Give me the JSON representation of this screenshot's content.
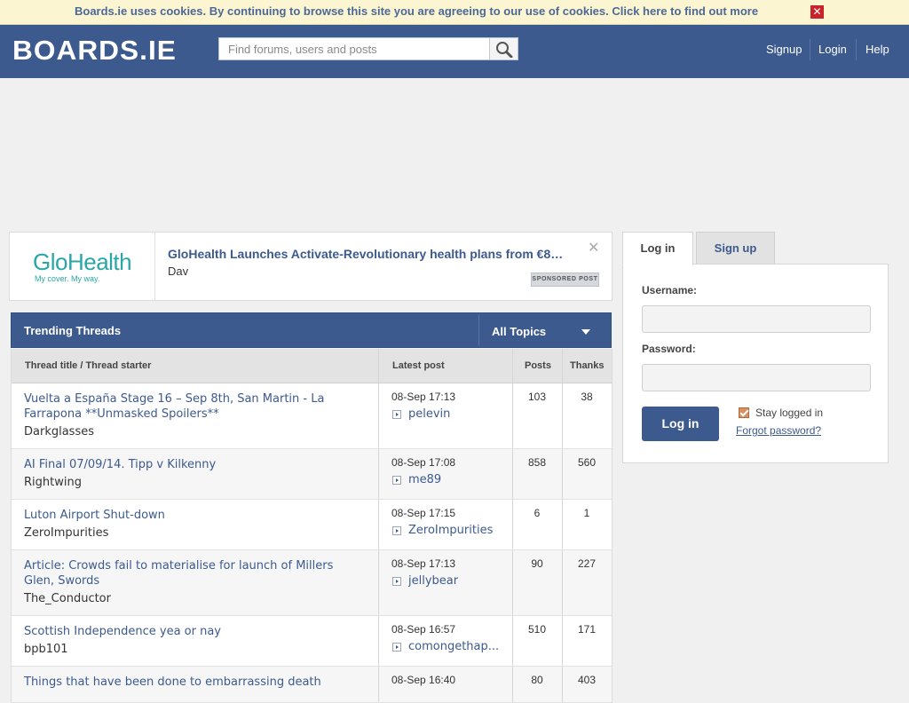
{
  "cookie_bar": {
    "message": "Boards.ie uses cookies. By continuing to browse this site you are agreeing to our use of cookies. Click here to find out more",
    "close_glyph": "✕"
  },
  "header": {
    "logo": "BOARDS.IE",
    "search_placeholder": "Find forums, users and posts",
    "nav": [
      "Signup",
      "Login",
      "Help"
    ]
  },
  "sponsored": {
    "logo_main": "GloHealth",
    "logo_sub": "My cover. My way.",
    "title": "GloHealth Launches Activate-Revolutionary health plans from €8…",
    "author": "Dav",
    "close_glyph": "✕",
    "badge": "SPONSORED POST"
  },
  "trending": {
    "title": "Trending Threads",
    "filter": "All Topics",
    "columns": [
      "Thread title / Thread starter",
      "Latest post",
      "Posts",
      "Thanks"
    ],
    "rows": [
      {
        "title": "Vuelta a España Stage 16 – Sep 8th, San Martin - La Farrapona **Unmasked Spoilers**",
        "starter": "Darkglasses",
        "date": "08-Sep 17:13",
        "last_user": "pelevin",
        "posts": "103",
        "thanks": "38"
      },
      {
        "title": "AI Final 07/09/14. Tipp v Kilkenny",
        "starter": "Rightwing",
        "date": "08-Sep 17:08",
        "last_user": "me89",
        "posts": "858",
        "thanks": "560"
      },
      {
        "title": "Luton Airport Shut-down",
        "starter": "ZeroImpurities",
        "date": "08-Sep 17:15",
        "last_user": "ZeroImpurities",
        "posts": "6",
        "thanks": "1"
      },
      {
        "title": "Article: Crowds fail to materialise for launch of Millers Glen, Swords",
        "starter": "The_Conductor",
        "date": "08-Sep 17:13",
        "last_user": "jellybear",
        "posts": "90",
        "thanks": "227"
      },
      {
        "title": "Scottish Independence yea or nay",
        "starter": "bpb101",
        "date": "08-Sep 16:57",
        "last_user": "comongethap...",
        "posts": "510",
        "thanks": "171"
      },
      {
        "title": "Things that have been done to embarrassing death",
        "starter": "",
        "date": "08-Sep 16:40",
        "last_user": "",
        "posts": "80",
        "thanks": "403"
      }
    ]
  },
  "login": {
    "tab_login": "Log in",
    "tab_signup": "Sign up",
    "username_label": "Username:",
    "password_label": "Password:",
    "button": "Log in",
    "stay": "Stay logged in",
    "forgot": "Forgot password?"
  },
  "colors": {
    "brand": "#3c5a8e",
    "cookie_bg": "#fbf5d2",
    "close_red": "#c8232b",
    "glohealth_teal": "#2aa6a6"
  }
}
